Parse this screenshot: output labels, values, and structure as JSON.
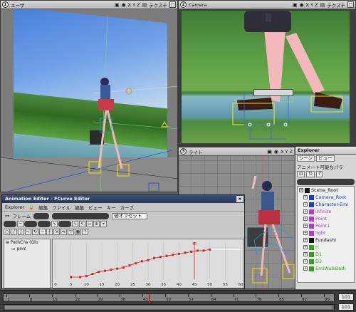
{
  "viewports": {
    "perspective": {
      "number": "1",
      "name": "ユーザ",
      "axes": "X Y Z",
      "extra": "テクスチ"
    },
    "camera": {
      "number": "2",
      "name": "Camera",
      "axes": "X Y Z",
      "extra": "テクスチ"
    },
    "right": {
      "number": "3",
      "name": "ライト",
      "axes": "X Y Z"
    }
  },
  "explorer": {
    "title": "Explorer",
    "scene_filter": "シーン",
    "view_label": "ビュー",
    "animatable_label": "アニメート可能なパラ",
    "tree": [
      {
        "label": "Scene_Root",
        "color": "#111111"
      },
      {
        "label": "Camera_Root",
        "color": "#1a3fc2"
      },
      {
        "label": "Character-Emi",
        "color": "#1a3fc2"
      },
      {
        "label": "infinite",
        "color": "#b33ad0"
      },
      {
        "label": "Point",
        "color": "#b33ad0"
      },
      {
        "label": "Point1",
        "color": "#b33ad0"
      },
      {
        "label": "light",
        "color": "#b33ad0"
      },
      {
        "label": "Fundashi",
        "color": "#111111"
      },
      {
        "label": "H",
        "color": "#35a020"
      },
      {
        "label": "D1",
        "color": "#35a020"
      },
      {
        "label": "D2",
        "color": "#35a020"
      },
      {
        "label": "EmiWalkBath",
        "color": "#35a020"
      }
    ]
  },
  "anim_editor": {
    "title": "Animation Editor - FCurve Editor",
    "close": "×",
    "menu": [
      "Explorer",
      "編集",
      "ファイル",
      "編集",
      "ビュー",
      "キー",
      "カーブ"
    ],
    "frame_label": "フレーム",
    "offset_label": "値オフセット",
    "tree": [
      {
        "label": "PathCns (Glo"
      },
      {
        "label": "perc"
      }
    ],
    "axis_ticks": [
      "0",
      "5",
      "10",
      "15",
      "20",
      "25",
      "30",
      "35",
      "40",
      "45",
      "50",
      "55",
      "60"
    ],
    "marker_label": "45"
  },
  "chart_data": {
    "type": "line",
    "series": [
      {
        "values": [
          [
            5,
            2
          ],
          [
            8,
            2
          ],
          [
            10,
            3
          ],
          [
            12,
            5
          ],
          [
            14,
            7
          ],
          [
            16,
            8
          ],
          [
            18,
            9
          ],
          [
            20,
            10
          ],
          [
            22,
            11
          ],
          [
            24,
            13
          ],
          [
            26,
            15
          ],
          [
            28,
            17
          ],
          [
            30,
            18
          ],
          [
            32,
            20
          ],
          [
            34,
            21
          ],
          [
            36,
            22
          ],
          [
            38,
            23
          ],
          [
            40,
            24
          ],
          [
            42,
            25
          ],
          [
            44,
            26
          ],
          [
            46,
            27
          ],
          [
            48,
            27
          ],
          [
            50,
            28
          ]
        ]
      }
    ],
    "xlim": [
      0,
      60
    ],
    "ylim": [
      0,
      35
    ],
    "current_frame": 45
  },
  "timeline": {
    "ticks": [
      "1",
      "8",
      "15",
      "22",
      "29",
      "36",
      "43",
      "50",
      "57",
      "64",
      "71",
      "78",
      "85",
      "92",
      "99"
    ],
    "end_value": "101",
    "end_value_2": "101",
    "current": "45"
  },
  "colors": {
    "selection": "#f5e400",
    "curve": "#d82020",
    "timeline_marker": "#d82020"
  }
}
